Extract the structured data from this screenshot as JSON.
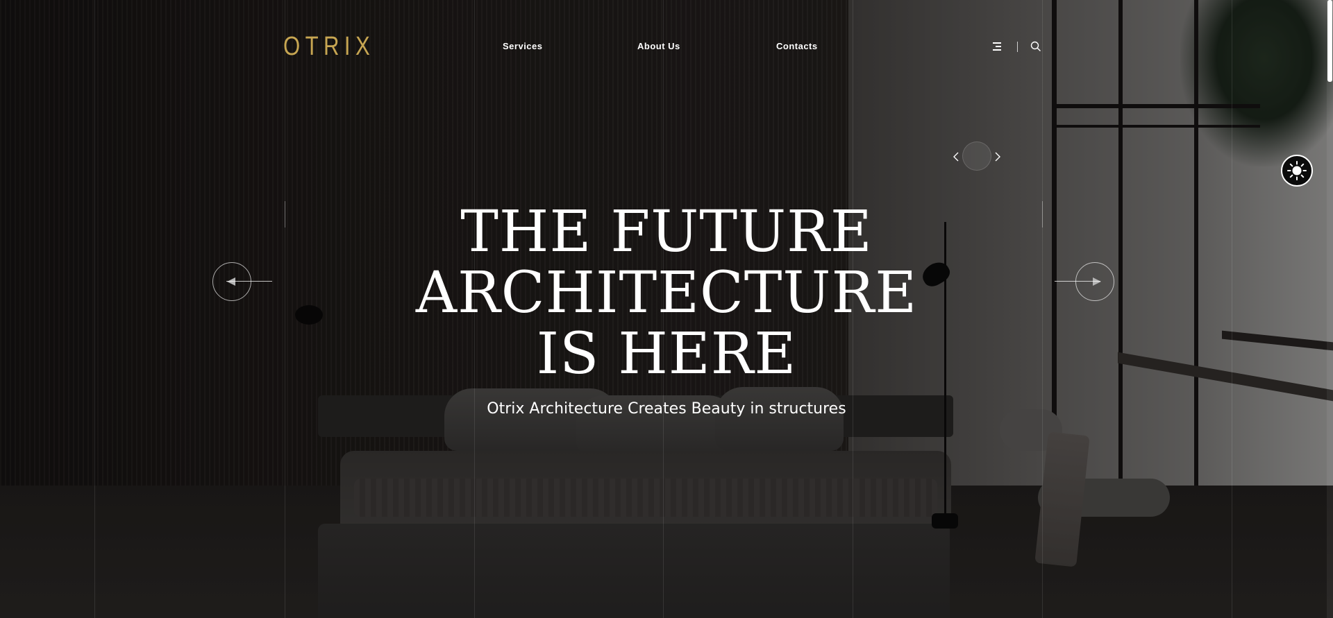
{
  "header": {
    "logo_text": "OTRIX",
    "nav": [
      {
        "label": "Services"
      },
      {
        "label": "About Us"
      },
      {
        "label": "Contacts"
      }
    ],
    "menu_icon": "hamburger-menu-icon",
    "search_icon": "search-icon"
  },
  "hero": {
    "title_lines": [
      "THE FUTURE",
      "ARCHITECTURE",
      "IS HERE"
    ],
    "subtitle": "Otrix Architecture Creates Beauty in structures"
  },
  "slider": {
    "prev_icon": "arrow-left-icon",
    "next_icon": "arrow-right-icon",
    "mini_prev_icon": "chevron-left-icon",
    "mini_next_icon": "chevron-right-icon"
  },
  "theme_toggle": {
    "icon": "sun-icon"
  },
  "colors": {
    "brand_gold": "#c7a652",
    "text": "#ffffff",
    "background": "#1a1817"
  }
}
